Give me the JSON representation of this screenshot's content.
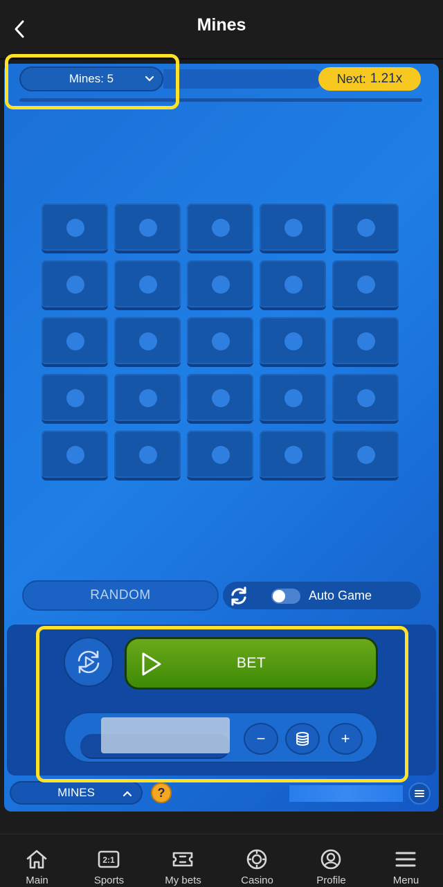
{
  "header": {
    "title": "Mines"
  },
  "game": {
    "mines_select_label": "Mines: 5",
    "next_prefix": "Next:",
    "next_value": "1.21x",
    "random_label": "RANDOM",
    "auto_game_label": "Auto Game",
    "auto_game_enabled": false,
    "bet_label": "BET",
    "minus_label": "−",
    "plus_label": "+",
    "game_switch_label": "MINES",
    "help_label": "?"
  },
  "nav": {
    "items": [
      {
        "label": "Main",
        "icon": "home-icon"
      },
      {
        "label": "Sports",
        "icon": "sports-icon"
      },
      {
        "label": "My bets",
        "icon": "ticket-icon"
      },
      {
        "label": "Casino",
        "icon": "casino-chip-icon"
      },
      {
        "label": "Profile",
        "icon": "profile-icon"
      },
      {
        "label": "Menu",
        "icon": "menu-icon"
      }
    ]
  },
  "colors": {
    "highlight": "#ffe12a",
    "bet_green": "#4e9a0e",
    "next_badge": "#f7c820",
    "game_blue": "#1f7fe6"
  }
}
